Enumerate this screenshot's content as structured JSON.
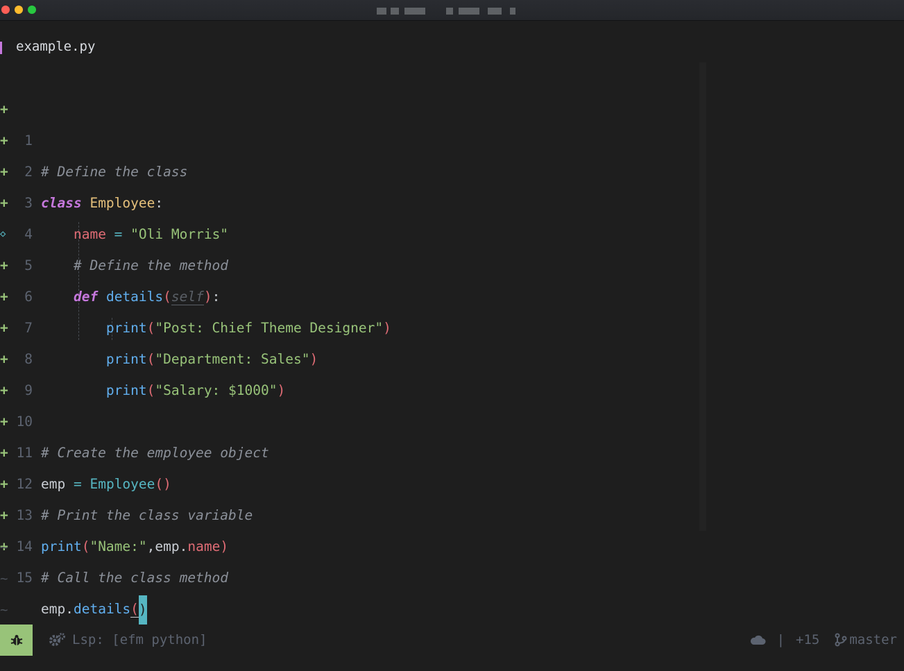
{
  "window": {
    "title": ""
  },
  "tab": {
    "filename": "example.py"
  },
  "editor": {
    "lines": [
      {
        "num": "1",
        "sign": "+"
      },
      {
        "num": "2",
        "sign": "+"
      },
      {
        "num": "3",
        "sign": "+"
      },
      {
        "num": "4",
        "sign": "+"
      },
      {
        "num": "5",
        "sign": "◇"
      },
      {
        "num": "6",
        "sign": "+"
      },
      {
        "num": "7",
        "sign": "+"
      },
      {
        "num": "8",
        "sign": "+"
      },
      {
        "num": "9",
        "sign": "+"
      },
      {
        "num": "10",
        "sign": "+"
      },
      {
        "num": "11",
        "sign": "+"
      },
      {
        "num": "12",
        "sign": "+"
      },
      {
        "num": "13",
        "sign": "+"
      },
      {
        "num": "14",
        "sign": "+"
      },
      {
        "num": "15",
        "sign": "+"
      }
    ],
    "code": {
      "l1_comment": "# Define the class",
      "l2_kw": "class",
      "l2_name": "Employee",
      "l2_colon": ":",
      "l3_var": "name",
      "l3_eq": " = ",
      "l3_str": "\"Oli Morris\"",
      "l4_comment": "# Define the method",
      "l5_kw": "def",
      "l5_fn": "details",
      "l5_open": "(",
      "l5_self": "self",
      "l5_close": ")",
      "l5_colon": ":",
      "l6_fn": "print",
      "l6_open": "(",
      "l6_str": "\"Post: Chief Theme Designer\"",
      "l6_close": ")",
      "l7_fn": "print",
      "l7_open": "(",
      "l7_str": "\"Department: Sales\"",
      "l7_close": ")",
      "l8_fn": "print",
      "l8_open": "(",
      "l8_str": "\"Salary: $1000\"",
      "l8_close": ")",
      "l10_comment": "# Create the employee object",
      "l11_var": "emp",
      "l11_eq": " = ",
      "l11_ctor": "Employee",
      "l11_parens": "()",
      "l12_comment": "# Print the class variable",
      "l13_fn": "print",
      "l13_open": "(",
      "l13_str": "\"Name:\"",
      "l13_comma": ",",
      "l13_obj": "emp",
      "l13_dot": ".",
      "l13_attr": "name",
      "l13_close": ")",
      "l14_comment": "# Call the class method",
      "l15_obj": "emp",
      "l15_dot": ".",
      "l15_method": "details",
      "l15_open": "(",
      "l15_cursor": ")"
    },
    "empty_marker": "~"
  },
  "statusbar": {
    "lsp_label": "Lsp: [efm python]",
    "separator": "|",
    "diff_added": "+15",
    "branch": "master",
    "mode_color": "#98c379"
  },
  "icons": {
    "mode": "bug-icon",
    "lsp": "gears-icon",
    "cloud": "cloud-icon",
    "branch": "git-branch-icon"
  }
}
